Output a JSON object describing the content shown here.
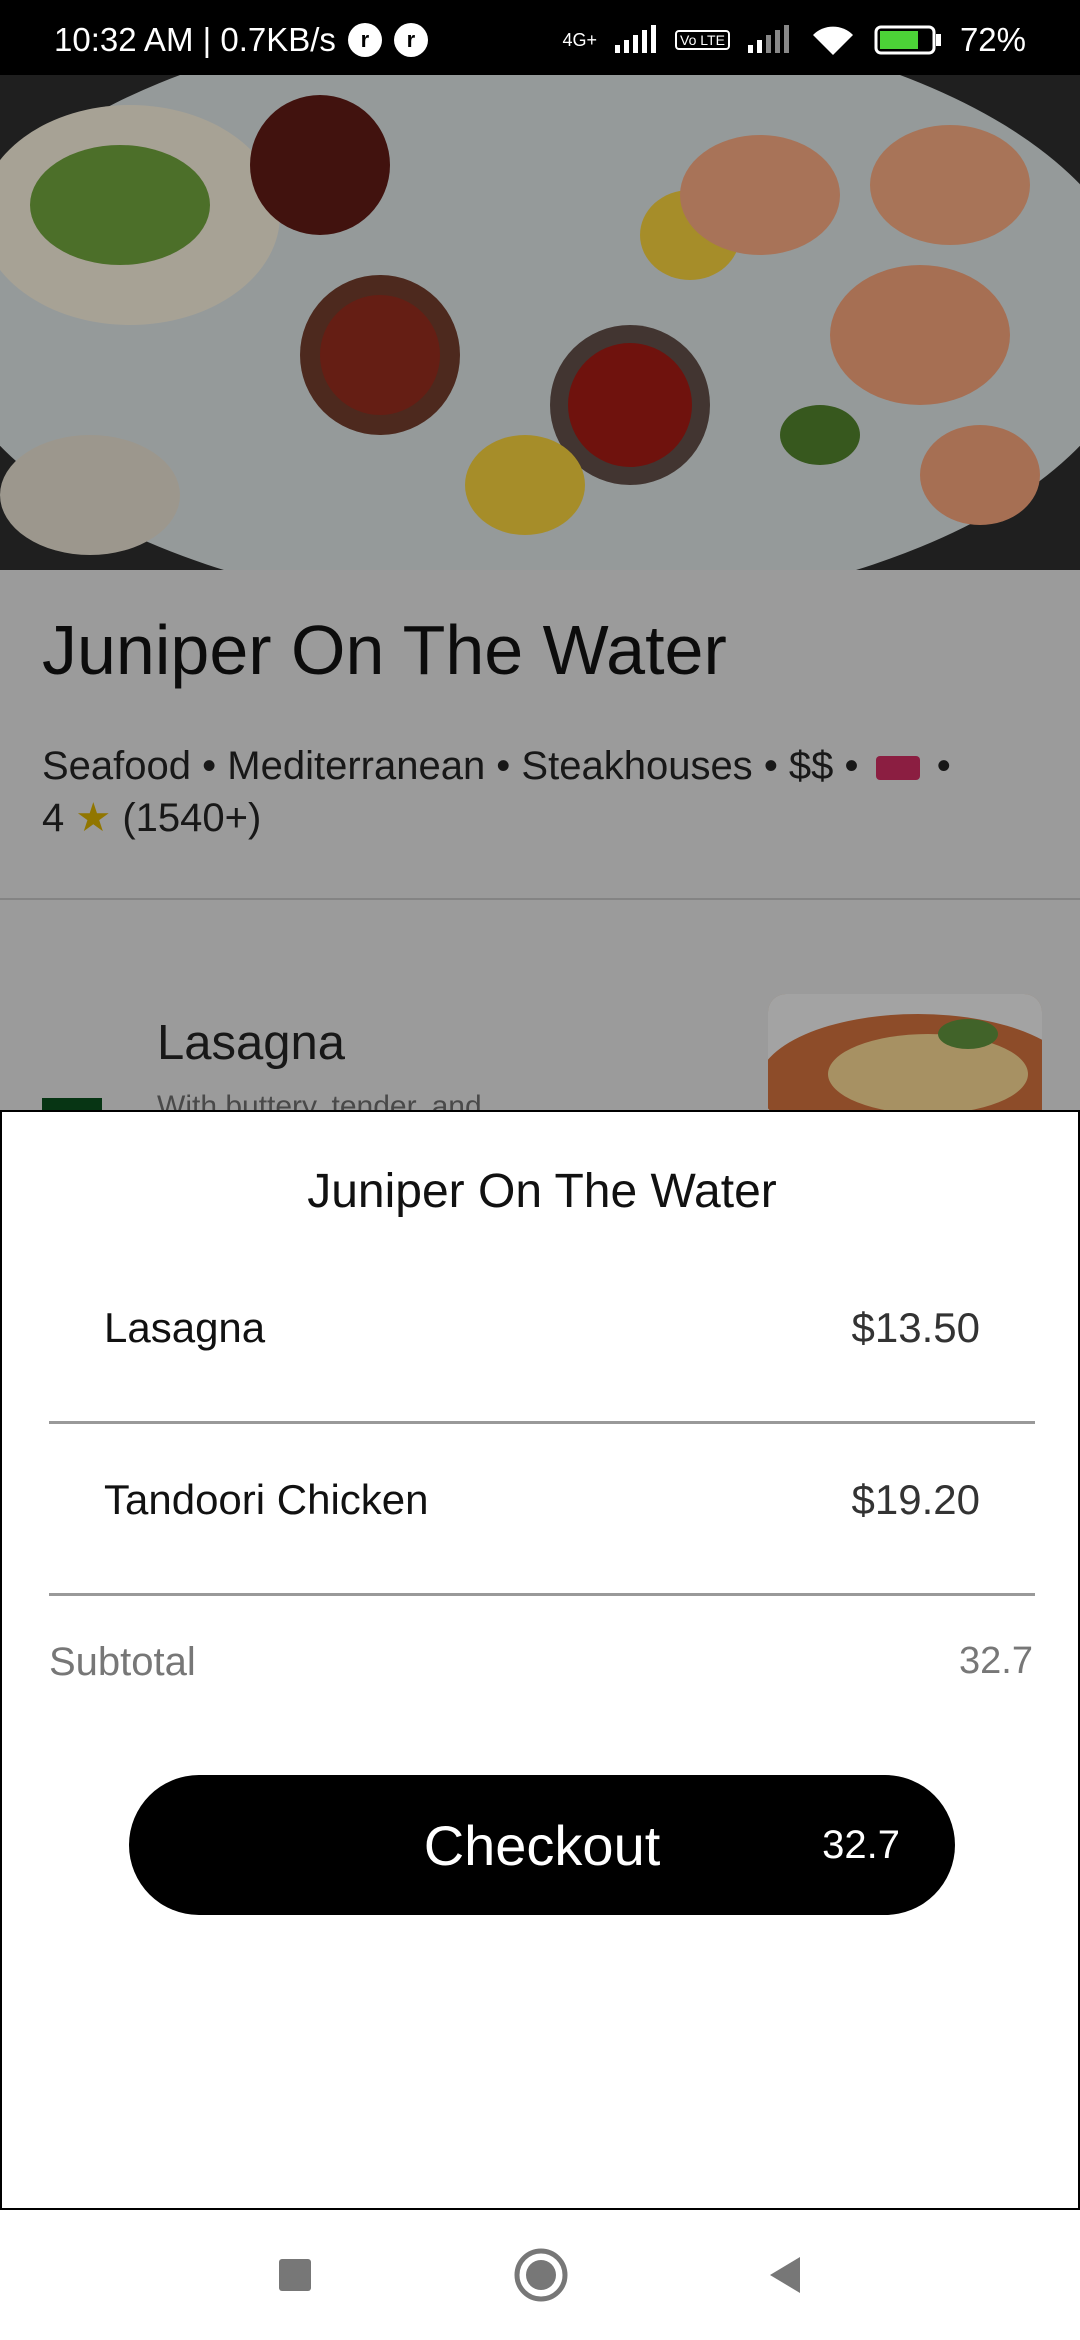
{
  "status_bar": {
    "time_speed": "10:32 AM | 0.7KB/s",
    "network": "4G+",
    "volte": "Vo LTE",
    "battery": "72%"
  },
  "restaurant": {
    "name": "Juniper On The Water",
    "categories": "Seafood • Mediterranean • Steakhouses",
    "price": "• $$ •",
    "rating_sep": "•",
    "rating": "4",
    "review_count": "(1540+)"
  },
  "menu_peek": {
    "item_name": "Lasagna",
    "item_desc": "With buttery, tender, and"
  },
  "cart_sheet": {
    "title": "Juniper On The Water",
    "items": [
      {
        "name": "Lasagna",
        "price": "$13.50"
      },
      {
        "name": "Tandoori Chicken",
        "price": "$19.20"
      }
    ],
    "subtotal_label": "Subtotal",
    "subtotal_value": "32.7",
    "checkout_label": "Checkout",
    "checkout_total": "32.7"
  },
  "icons": {
    "nav_recents": "square-icon",
    "nav_home": "circle-icon",
    "nav_back": "triangle-back-icon"
  },
  "colors": {
    "primary_button": "#000000",
    "sheet_background": "#ffffff",
    "ticket_badge": "#c12a5b",
    "veg_badge": "#0a4a1c"
  }
}
